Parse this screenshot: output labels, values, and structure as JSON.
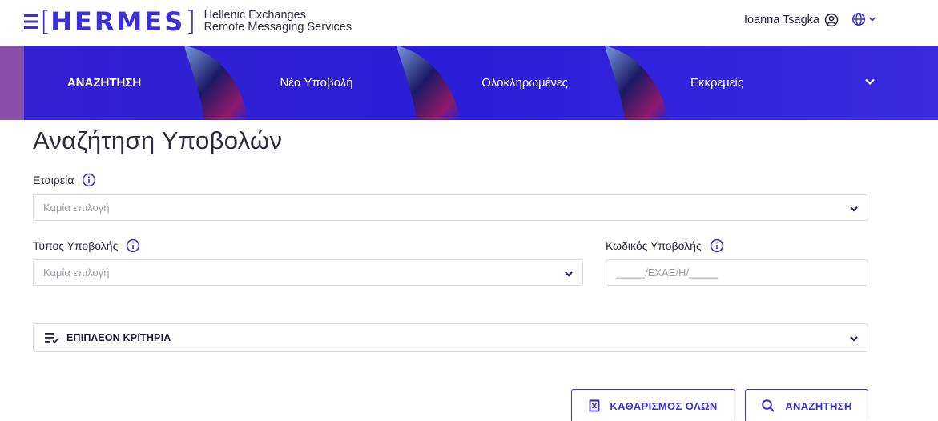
{
  "header": {
    "logo_text": "HERMES",
    "logo_subtitle_line1": "Hellenic Exchanges",
    "logo_subtitle_line2": "Remote Messaging Services",
    "user_name": "Ioanna Tsagka",
    "user_icon": "user-circle-icon",
    "language_icon": "globe-icon"
  },
  "nav": {
    "items": [
      {
        "label": "ΑΝΑΖΗΤΗΣΗ",
        "active": true
      },
      {
        "label": "Νέα Υποβολή",
        "active": false
      },
      {
        "label": "Ολοκληρωμένες",
        "active": false
      },
      {
        "label": "Εκκρεμείς",
        "active": false
      }
    ],
    "more_icon": "chevron-down-icon"
  },
  "page": {
    "title": "Αναζήτηση Υποβολών"
  },
  "form": {
    "company": {
      "label": "Εταιρεία",
      "value": "Καμία επιλογή"
    },
    "submission_type": {
      "label": "Τύπος Υποβολής",
      "value": "Καμία επιλογή"
    },
    "submission_code": {
      "label": "Κωδικός Υποβολής",
      "placeholder": "_____/ΕΧΑΕ/Η/_____"
    },
    "more_criteria": {
      "label": "ΕΠΙΠΛΕΟΝ ΚΡΙΤΗΡΙΑ"
    }
  },
  "actions": {
    "clear_label": "ΚΑΘΑΡΙΣΜΟΣ ΟΛΩΝ",
    "search_label": "ΑΝΑΖΗΤΗΣΗ"
  },
  "colors": {
    "brand": "#3b2fd8",
    "nav_bg": "#2b1fd6",
    "border": "#dcdce6",
    "placeholder": "#9a9aaa"
  }
}
